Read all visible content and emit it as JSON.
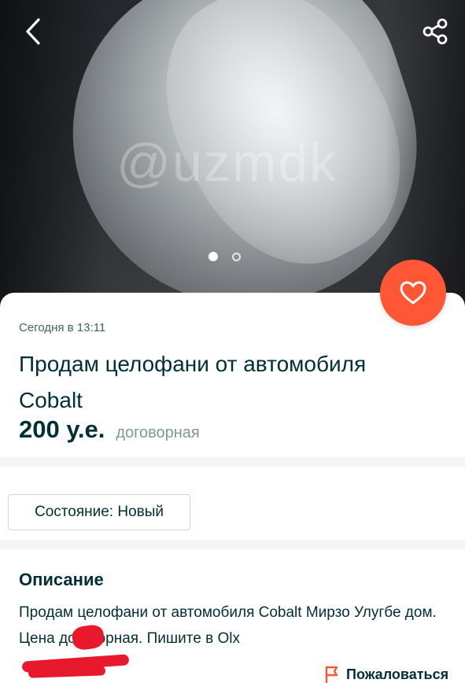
{
  "gallery": {
    "watermark": "@uzmdk",
    "page_indicator": {
      "current": 1,
      "total": 2
    }
  },
  "icons": {
    "back": "chevron-left-icon",
    "share": "share-icon",
    "favorite": "heart-icon",
    "report": "flag-icon"
  },
  "colors": {
    "accent": "#ff5636",
    "text": "#002f34",
    "muted": "#7f9799",
    "separator": "#f2f4f5"
  },
  "listing": {
    "date": "Сегодня в 13:11",
    "title": "Продам целофани от автомобиля Cobalt",
    "price": "200 у.е.",
    "price_note": "договорная"
  },
  "attributes": {
    "condition": "Состояние: Новый"
  },
  "description": {
    "heading": "Описание",
    "text": "Продам целофани от автомобиля Cobalt Мирзо Улугбе   дом. Цена договорная. Пишите в Olx"
  },
  "actions": {
    "report_label": "Пожаловаться"
  }
}
